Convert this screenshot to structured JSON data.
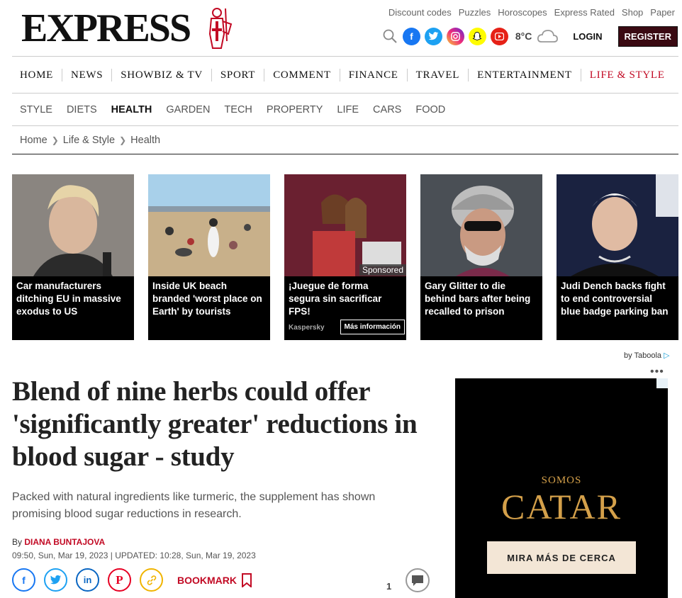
{
  "brand": {
    "logo_text": "EXPRESS"
  },
  "top_links": [
    "Discount codes",
    "Puzzles",
    "Horoscopes",
    "Express Rated",
    "Shop",
    "Paper"
  ],
  "header": {
    "temperature": "8°C",
    "login_label": "LOGIN",
    "register_label": "REGISTER",
    "social": [
      {
        "name": "facebook",
        "glyph": "f",
        "color": "#1877f2"
      },
      {
        "name": "twitter",
        "glyph": "t",
        "color": "#1da1f2"
      },
      {
        "name": "instagram",
        "glyph": "◎",
        "color": "#d62976"
      },
      {
        "name": "snapchat",
        "glyph": "◉",
        "color": "#fffc00"
      },
      {
        "name": "youtube",
        "glyph": "▶",
        "color": "#e62117"
      }
    ]
  },
  "main_nav": [
    "HOME",
    "NEWS",
    "SHOWBIZ & TV",
    "SPORT",
    "COMMENT",
    "FINANCE",
    "TRAVEL",
    "ENTERTAINMENT",
    "LIFE & STYLE"
  ],
  "sub_nav": [
    "STYLE",
    "DIETS",
    "HEALTH",
    "GARDEN",
    "TECH",
    "PROPERTY",
    "LIFE",
    "CARS",
    "FOOD"
  ],
  "breadcrumb": [
    "Home",
    "Life & Style",
    "Health"
  ],
  "teasers": [
    {
      "caption": "Car manufacturers ditching EU in massive exodus to US"
    },
    {
      "caption": "Inside UK beach branded 'worst place on Earth' by tourists"
    },
    {
      "caption": "¡Juegue de forma segura sin sacrificar FPS!",
      "sponsored": "Sponsored",
      "advertiser": "Kaspersky",
      "cta": "Más información"
    },
    {
      "caption": "Gary Glitter to die behind bars after being recalled to prison"
    },
    {
      "caption": "Judi Dench backs fight to end controversial blue badge parking ban"
    }
  ],
  "taboola": "by Taboola",
  "article": {
    "headline": "Blend of nine herbs could offer 'significantly greater' reductions in blood sugar - study",
    "standfirst": "Packed with natural ingredients like turmeric, the supplement has shown promising blood sugar reductions in research.",
    "by_prefix": "By ",
    "author": "DIANA BUNTAJOVA",
    "dateline": "09:50, Sun, Mar 19, 2023 | UPDATED: 10:28, Sun, Mar 19, 2023",
    "bookmark_label": "BOOKMARK",
    "comment_count": "1"
  },
  "ad": {
    "line1": "SOMOS",
    "line2": "CATAR",
    "cta": "MIRA MÁS DE CERCA"
  }
}
